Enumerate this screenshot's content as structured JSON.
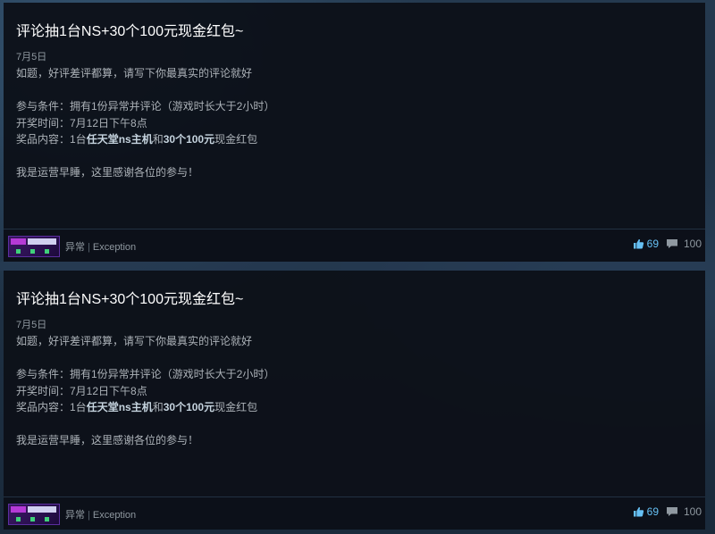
{
  "posts": [
    {
      "title": "评论抽1台NS+30个100元现金红包~",
      "date": "7月5日",
      "body": {
        "line1": "如题，好评差评都算，请写下你最真实的评论就好",
        "line2": "参与条件：拥有1份异常并评论（游戏时长大于2小时）",
        "line3": "开奖时间：7月12日下午8点",
        "line4_prefix": "奖品内容：1台",
        "line4_bold1": "任天堂ns主机",
        "line4_mid": "和",
        "line4_bold2": "30个100元",
        "line4_suffix": "现金红包",
        "line5": "我是运营早睡，这里感谢各位的参与！"
      },
      "author": {
        "name": "异常",
        "separator": "|",
        "name_en": "Exception",
        "avatar_icon": "exception-logo"
      },
      "likes": "69",
      "likes_icon": "thumbs-up-icon",
      "comments": "100",
      "comments_icon": "comment-bubble-icon"
    },
    {
      "title": "评论抽1台NS+30个100元现金红包~",
      "date": "7月5日",
      "body": {
        "line1": "如题，好评差评都算，请写下你最真实的评论就好",
        "line2": "参与条件：拥有1份异常并评论（游戏时长大于2小时）",
        "line3": "开奖时间：7月12日下午8点",
        "line4_prefix": "奖品内容：1台",
        "line4_bold1": "任天堂ns主机",
        "line4_mid": "和",
        "line4_bold2": "30个100元",
        "line4_suffix": "现金红包",
        "line5": "我是运营早睡，这里感谢各位的参与！"
      },
      "author": {
        "name": "异常",
        "separator": "|",
        "name_en": "Exception",
        "avatar_icon": "exception-logo"
      },
      "likes": "69",
      "likes_icon": "thumbs-up-icon",
      "comments": "100",
      "comments_icon": "comment-bubble-icon"
    }
  ],
  "colors": {
    "title": "#ffffff",
    "body": "#acb2b8",
    "muted": "#8f98a0",
    "accent": "#66c0f4",
    "panel": "#0c1119"
  }
}
